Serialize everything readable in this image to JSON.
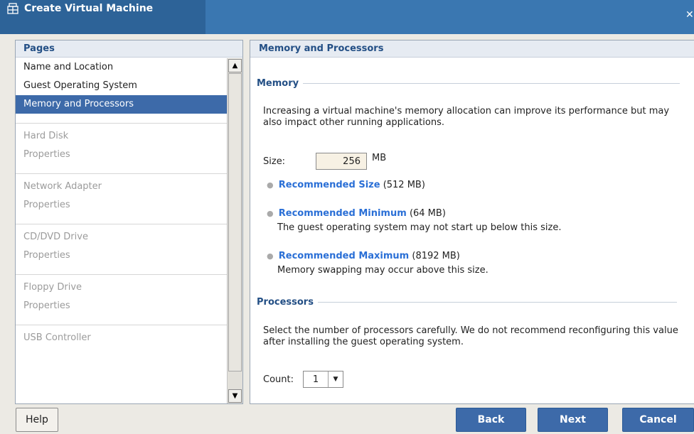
{
  "window": {
    "title": "Create Virtual Machine",
    "close_glyph": "✕"
  },
  "pages": {
    "header": "Pages",
    "items": [
      {
        "label": "Name and Location",
        "state": "normal"
      },
      {
        "label": "Guest Operating System",
        "state": "normal"
      },
      {
        "label": "Memory and Processors",
        "state": "selected"
      }
    ],
    "groups": [
      {
        "label": "Hard Disk",
        "sub": "Properties"
      },
      {
        "label": "Network Adapter",
        "sub": "Properties"
      },
      {
        "label": "CD/DVD Drive",
        "sub": "Properties"
      },
      {
        "label": "Floppy Drive",
        "sub": "Properties"
      },
      {
        "label": "USB Controller"
      }
    ]
  },
  "content": {
    "header": "Memory and Processors",
    "memory": {
      "heading": "Memory",
      "description": "Increasing a virtual machine's memory allocation can improve its performance but may also impact other running applications.",
      "size_label": "Size:",
      "size_value": "256",
      "size_unit": "MB",
      "recommendations": [
        {
          "label": "Recommended Size",
          "value": "(512 MB)",
          "note": ""
        },
        {
          "label": "Recommended Minimum",
          "value": "(64 MB)",
          "note": "The guest operating system may not start up below this size."
        },
        {
          "label": "Recommended Maximum",
          "value": "(8192 MB)",
          "note": "Memory swapping may occur above this size."
        }
      ]
    },
    "processors": {
      "heading": "Processors",
      "description": "Select the number of processors carefully. We do not recommend reconfiguring this value after installing the guest operating system.",
      "count_label": "Count:",
      "count_value": "1"
    }
  },
  "buttons": {
    "help": "Help",
    "back": "Back",
    "next": "Next",
    "cancel": "Cancel"
  },
  "colors": {
    "title_bar": "#3a77b1",
    "accent": "#3d6aa9",
    "heading_text": "#234f85",
    "link": "#2a6fd6"
  }
}
